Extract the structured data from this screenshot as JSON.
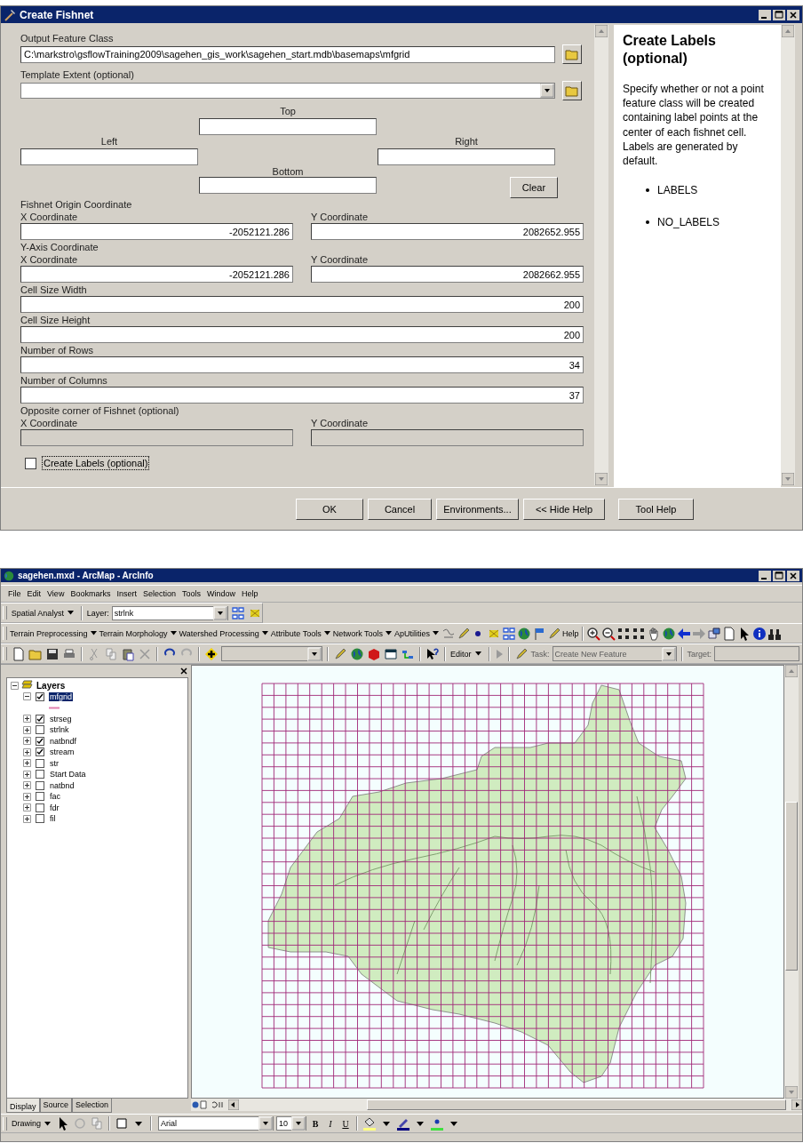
{
  "dialog": {
    "title": "Create Fishnet",
    "output": {
      "label": "Output Feature Class",
      "value": "C:\\markstro\\gsflowTraining2009\\sagehen_gis_work\\sagehen_start.mdb\\basemaps\\mfgrid"
    },
    "template": {
      "label": "Template Extent (optional)"
    },
    "extent": {
      "top": "Top",
      "left": "Left",
      "right": "Right",
      "bottom": "Bottom",
      "clear": "Clear"
    },
    "sections": [
      {
        "kind": "pair",
        "heading": "Fishnet Origin Coordinate",
        "x_label": "X Coordinate",
        "x_value": "-2052121.286",
        "y_label": "Y Coordinate",
        "y_value": "2082652.955",
        "disabled": false
      },
      {
        "kind": "pair",
        "heading": "Y-Axis Coordinate",
        "x_label": "X Coordinate",
        "x_value": "-2052121.286",
        "y_label": "Y Coordinate",
        "y_value": "2082662.955",
        "disabled": false
      },
      {
        "kind": "single",
        "label": "Cell Size Width",
        "value": "200"
      },
      {
        "kind": "single",
        "label": "Cell Size Height",
        "value": "200"
      },
      {
        "kind": "single",
        "label": "Number of Rows",
        "value": "34"
      },
      {
        "kind": "single",
        "label": "Number of Columns",
        "value": "37"
      },
      {
        "kind": "pair",
        "heading": "Opposite corner of Fishnet (optional)",
        "x_label": "X Coordinate",
        "y_label": "Y Coordinate",
        "disabled": true
      }
    ],
    "checkbox": {
      "label": "Create Labels (optional)",
      "checked": false
    },
    "help": {
      "title": "Create Labels (optional)",
      "text": "Specify whether or not a point feature class will be created containing label points at the center of each fishnet cell. Labels are generated by default.",
      "bullets": [
        "LABELS",
        "NO_LABELS"
      ]
    },
    "buttons": [
      "OK",
      "Cancel",
      "Environments...",
      "<< Hide Help",
      "Tool Help"
    ]
  },
  "arcmap": {
    "title": "sagehen.mxd - ArcMap - ArcInfo",
    "menu": [
      "File",
      "Edit",
      "View",
      "Bookmarks",
      "Insert",
      "Selection",
      "Tools",
      "Window",
      "Help"
    ],
    "spatial_analyst": {
      "menu": "Spatial Analyst",
      "layer_label": "Layer:",
      "layer_value": "strlnk"
    },
    "tool_menus": [
      "Terrain Preprocessing",
      "Terrain Morphology",
      "Watershed Processing",
      "Attribute Tools",
      "Network Tools",
      "ApUtilities"
    ],
    "help_button": "Help",
    "editor": {
      "menu": "Editor",
      "task_label": "Task:",
      "task_value": "Create New Feature",
      "target_label": "Target:"
    },
    "toc": {
      "root": {
        "name": "Layers",
        "expanded": true,
        "children": [
          {
            "name": "mfgrid",
            "checked": true,
            "expanded": true,
            "selected": true
          },
          {
            "name": "strseg",
            "checked": true,
            "expanded": false,
            "selected": false
          },
          {
            "name": "strlnk",
            "checked": false,
            "expanded": false,
            "selected": false
          },
          {
            "name": "natbndf",
            "checked": true,
            "expanded": false,
            "selected": false
          },
          {
            "name": "stream",
            "checked": true,
            "expanded": false,
            "selected": false
          },
          {
            "name": "str",
            "checked": false,
            "expanded": false,
            "selected": false
          },
          {
            "name": "Start Data",
            "checked": false,
            "expanded": false,
            "selected": false
          },
          {
            "name": "natbnd",
            "checked": false,
            "expanded": false,
            "selected": false
          },
          {
            "name": "fac",
            "checked": false,
            "expanded": false,
            "selected": false
          },
          {
            "name": "fdr",
            "checked": false,
            "expanded": false,
            "selected": false
          },
          {
            "name": "fil",
            "checked": false,
            "expanded": false,
            "selected": false
          }
        ]
      },
      "tabs": [
        {
          "label": "Display",
          "selected": true
        },
        {
          "label": "Source",
          "selected": false
        },
        {
          "label": "Selection",
          "selected": false
        }
      ]
    },
    "drawing": {
      "menu": "Drawing",
      "font": "Arial",
      "size": "10",
      "bold": "B",
      "italic": "I",
      "underline": "U"
    }
  }
}
